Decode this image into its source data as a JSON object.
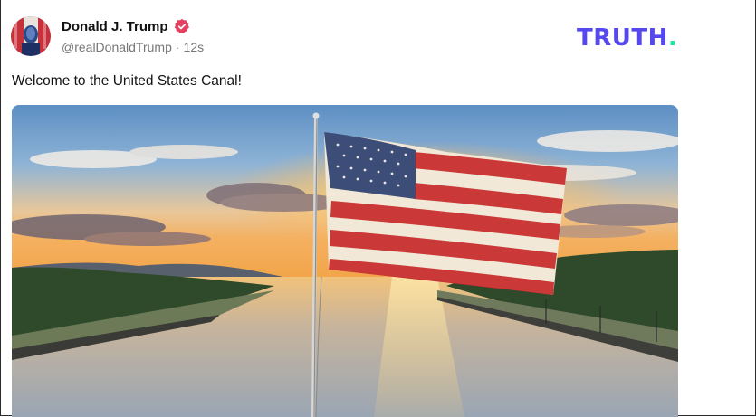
{
  "post": {
    "author": {
      "display_name": "Donald J. Trump",
      "handle": "@realDonaldTrump",
      "verified": true,
      "avatar_icon": "avatar-photo"
    },
    "separator": "·",
    "time_ago": "12s",
    "text": "Welcome to the United States Canal!",
    "media": {
      "type": "image",
      "description_icon": "flag-over-canal-photo"
    }
  },
  "brand": {
    "name": "TRUTH",
    "dot": ".",
    "color": "#5448ee",
    "dot_color": "#17e6a3"
  },
  "colors": {
    "verified_badge": "#e4405f",
    "handle_text": "#777777"
  }
}
